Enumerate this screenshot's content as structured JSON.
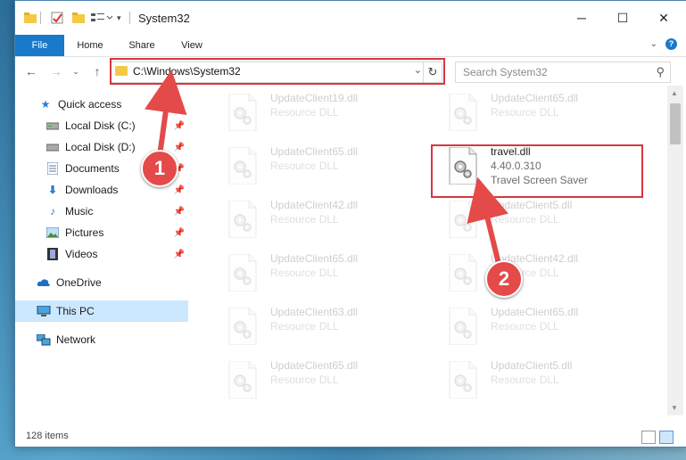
{
  "window": {
    "title": "System32",
    "controls": {
      "minimize": "─",
      "maximize": "☐",
      "close": "✕"
    }
  },
  "ribbon": {
    "tabs": [
      "File",
      "Home",
      "Share",
      "View"
    ]
  },
  "address": {
    "path": "C:\\Windows\\System32",
    "search_placeholder": "Search System32"
  },
  "sidebar": {
    "items": [
      {
        "label": "Quick access",
        "icon": "star-icon",
        "pinned": false
      },
      {
        "label": "Local Disk (C:)",
        "icon": "drive-icon",
        "pinned": true
      },
      {
        "label": "Local Disk (D:)",
        "icon": "drive-icon",
        "pinned": true
      },
      {
        "label": "Documents",
        "icon": "documents-icon",
        "pinned": true
      },
      {
        "label": "Downloads",
        "icon": "download-icon",
        "pinned": true
      },
      {
        "label": "Music",
        "icon": "music-icon",
        "pinned": true
      },
      {
        "label": "Pictures",
        "icon": "pictures-icon",
        "pinned": true
      },
      {
        "label": "Videos",
        "icon": "videos-icon",
        "pinned": true
      },
      {
        "label": "OneDrive",
        "icon": "cloud-icon",
        "pinned": false
      },
      {
        "label": "This PC",
        "icon": "computer-icon",
        "pinned": false,
        "selected": true
      },
      {
        "label": "Network",
        "icon": "network-icon",
        "pinned": false
      }
    ]
  },
  "files": {
    "left": [
      {
        "name": "UpdateClient19.dll",
        "type": "Resource DLL"
      },
      {
        "name": "UpdateClient65.dll",
        "type": "Resource DLL"
      },
      {
        "name": "UpdateClient42.dll",
        "type": "Resource DLL"
      },
      {
        "name": "UpdateClient65.dll",
        "type": "Resource DLL"
      },
      {
        "name": "UpdateClient63.dll",
        "type": "Resource DLL"
      },
      {
        "name": "UpdateClient65.dll",
        "type": "Resource DLL"
      }
    ],
    "right": [
      {
        "name": "UpdateClient65.dll",
        "type": "Resource DLL"
      },
      {
        "name": "travel.dll",
        "version": "4.40.0.310",
        "desc": "Travel Screen Saver",
        "highlighted": true
      },
      {
        "name": "UpdateClient5.dll",
        "type": "Resource DLL"
      },
      {
        "name": "UpdateClient42.dll",
        "type": "Resource DLL"
      },
      {
        "name": "UpdateClient65.dll",
        "type": "Resource DLL"
      },
      {
        "name": "UpdateClient5.dll",
        "type": "Resource DLL"
      }
    ]
  },
  "status": {
    "item_count": "128 items"
  },
  "annotations": {
    "step1": "1",
    "step2": "2",
    "color": "#d7373f"
  }
}
